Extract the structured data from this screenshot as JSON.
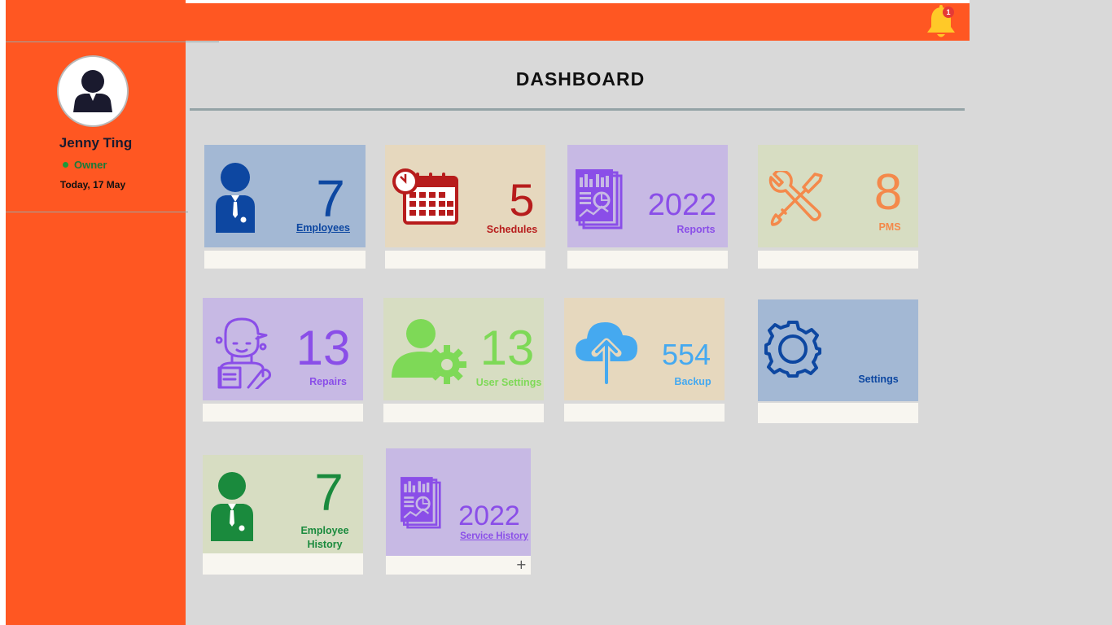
{
  "header": {
    "notification_count": "1",
    "page_title": "DASHBOARD"
  },
  "user": {
    "name": "Jenny Ting",
    "role": "Owner",
    "date": "Today, 17 May"
  },
  "colors": {
    "accent": "#ff5722",
    "background": "#d9d9d9",
    "card_footer": "#f8f6f0"
  },
  "cards": [
    {
      "value": "7",
      "label": "Employees",
      "icon": "employee-icon",
      "bg": "#a3b8d4",
      "fg": "#0d47a1"
    },
    {
      "value": "5",
      "label": "Schedules",
      "icon": "calendar-clock-icon",
      "bg": "#e6d8be",
      "fg": "#b71c1c"
    },
    {
      "value": "2022",
      "label": "Reports",
      "icon": "report-icon",
      "bg": "#c7b9e4",
      "fg": "#8a4ee8"
    },
    {
      "value": "8",
      "label": "PMS",
      "icon": "tools-icon",
      "bg": "#d7ddc2",
      "fg": "#f4894b"
    },
    {
      "value": "13",
      "label": "Repairs",
      "icon": "mechanic-icon",
      "bg": "#c7b9e4",
      "fg": "#8a4ee8"
    },
    {
      "value": "13",
      "label": "User Settings",
      "icon": "user-gear-icon",
      "bg": "#d7ddc2",
      "fg": "#7ed957"
    },
    {
      "value": "554",
      "label": "Backup",
      "icon": "cloud-upload-icon",
      "bg": "#e6d8be",
      "fg": "#45a9f0"
    },
    {
      "value": "",
      "label": "Settings",
      "icon": "gear-icon",
      "bg": "#a3b8d4",
      "fg": "#0d47a1"
    },
    {
      "value": "7",
      "label": "Employee History",
      "icon": "employee-icon",
      "bg": "#d7ddc2",
      "fg": "#1a8a3d"
    },
    {
      "value": "2022",
      "label": "Service History",
      "icon": "report-icon",
      "bg": "#c7b9e4",
      "fg": "#8a4ee8"
    }
  ]
}
